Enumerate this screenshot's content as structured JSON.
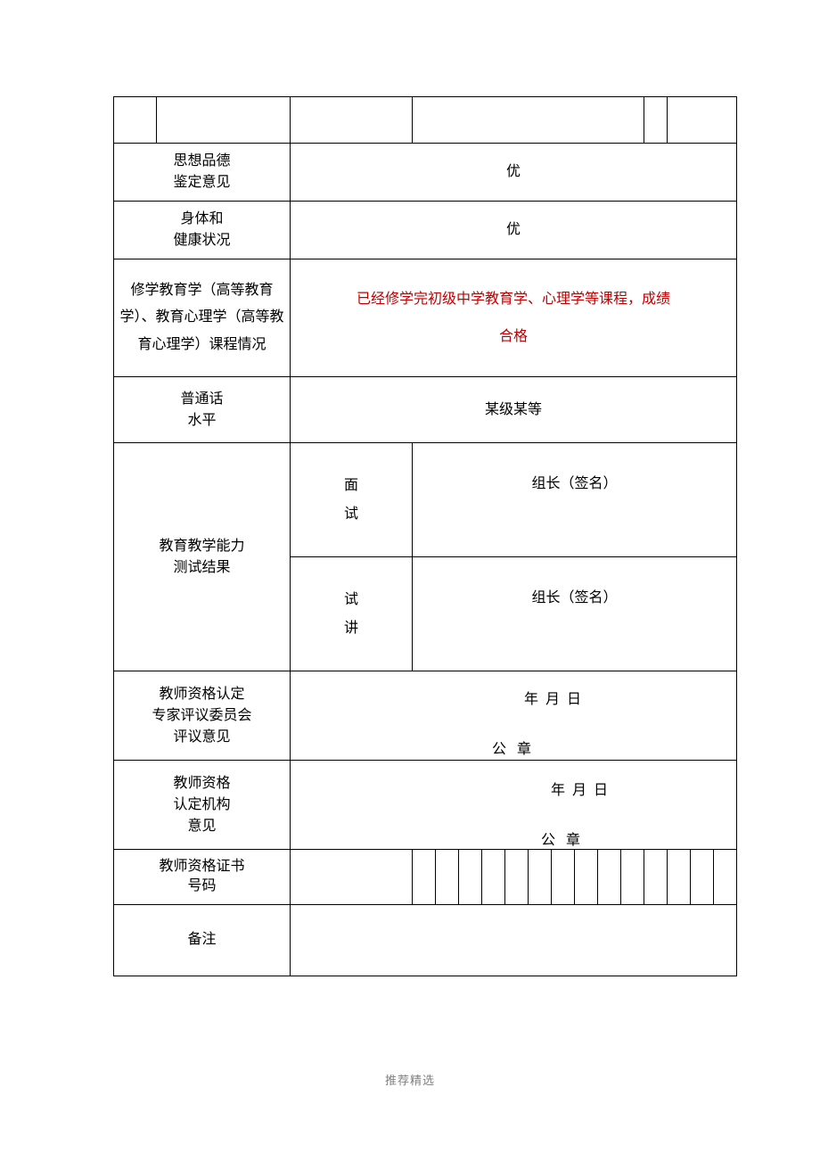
{
  "rows": {
    "moral": {
      "label": "思想品德\n鉴定意见",
      "value": "优"
    },
    "health": {
      "label": "身体和\n健康状况",
      "value": "优"
    },
    "courses": {
      "label": "修学教育学（高等教育学）、教育心理学（高等教育心理学）课程情况",
      "value_line1": "已经修学完初级中学教育学、心理学等课程，成绩",
      "value_line2": "合格"
    },
    "mandarin": {
      "label": "普通话\n水平",
      "value": "某级某等"
    },
    "test": {
      "label": "教育教学能力\n测试结果",
      "sub1_label": "面\n试",
      "sub1_sig": "组长（签名）",
      "sub2_label": "试\n讲",
      "sub2_sig": "组长（签名）"
    },
    "expert": {
      "label": "教师资格认定\n专家评议委员会\n评议意见",
      "stamp": "公 章",
      "date": "年    月    日"
    },
    "org": {
      "label": "教师资格\n认定机构\n意见",
      "stamp": "公 章",
      "date": "年    月    日"
    },
    "certno": {
      "label": "教师资格证书\n号码"
    },
    "remark": {
      "label": "备注"
    }
  },
  "footer": "推荐精选"
}
